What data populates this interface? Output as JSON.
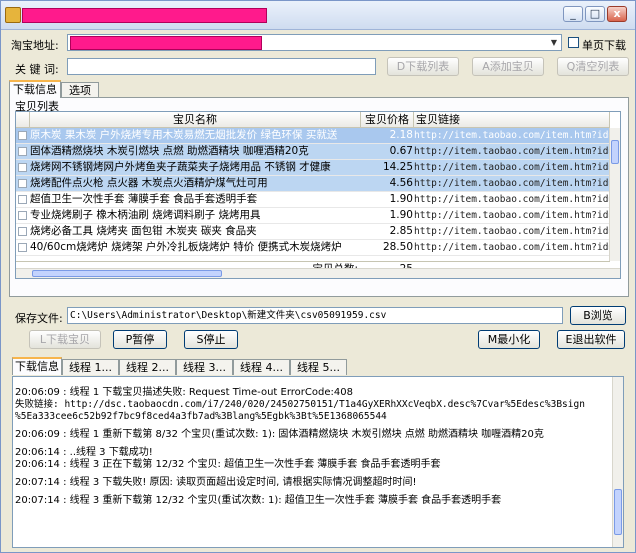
{
  "window": {
    "minimize_glyph": "_",
    "maximize_glyph": "□",
    "close_glyph": "x"
  },
  "top": {
    "url_label": "淘宝地址:",
    "single_page_label": "单页下载",
    "keyword_label": "关 键 词:",
    "download_list_button": "D下载列表",
    "add_item_button": "A添加宝贝",
    "clear_list_button": "Q清空列表"
  },
  "main_tabs": [
    {
      "label": "下载信息"
    },
    {
      "label": "选项"
    }
  ],
  "item_list": {
    "group_label": "宝贝列表",
    "columns": [
      "宝贝名称",
      "宝贝价格",
      "宝贝链接"
    ],
    "rows": [
      {
        "name": "原木炭 果木炭 户外烧烤专用木炭易燃无烟批发价 绿色环保 买就送",
        "price": "2.18",
        "link": "http://item.taobao.com/item.htm?id=2"
      },
      {
        "name": "固体酒精燃烧块 木炭引燃块 点燃 助燃酒精块 咖喱酒精20克",
        "price": "0.67",
        "link": "http://item.taobao.com/item.htm?id=2"
      },
      {
        "name": "烧烤网不锈钢烤网户外烤鱼夹子蔬菜夹子烧烤用品 不锈钢 才健康",
        "price": "14.25",
        "link": "http://item.taobao.com/item.htm?id=2"
      },
      {
        "name": "烧烤配件点火枪 点火器 木炭点火酒精炉煤气灶可用",
        "price": "4.56",
        "link": "http://item.taobao.com/item.htm?id=2"
      },
      {
        "name": "超值卫生一次性手套 薄膜手套 食品手套透明手套",
        "price": "1.90",
        "link": "http://item.taobao.com/item.htm?id=2"
      },
      {
        "name": "专业烧烤刷子 橡木柄油刷 烧烤调料刷子 烧烤用具",
        "price": "1.90",
        "link": "http://item.taobao.com/item.htm?id=2"
      },
      {
        "name": "烧烤必备工具 烧烤夹 面包钳 木炭夹 碳夹 食品夹",
        "price": "2.85",
        "link": "http://item.taobao.com/item.htm?id=1"
      },
      {
        "name": "40/60cm烧烤炉 烧烤架 户外冷扎板烧烤炉 特价 便携式木炭烧烤炉",
        "price": "28.50",
        "link": "http://item.taobao.com/item.htm?id=1"
      }
    ],
    "total_label": "宝贝总数:",
    "total_value": "25"
  },
  "save": {
    "label": "保存文件:",
    "path": "C:\\Users\\Administrator\\Desktop\\新建文件夹\\csv05091959.csv",
    "browse_button": "B浏览"
  },
  "actions": {
    "start_download_button": "L下载宝贝",
    "pause_button": "P暂停",
    "stop_button": "S停止",
    "minimize_button": "M最小化",
    "exit_button": "E退出软件"
  },
  "log_tabs": [
    {
      "label": "下载信息"
    },
    {
      "label": "线程 1..."
    },
    {
      "label": "线程 2..."
    },
    {
      "label": "线程 3..."
    },
    {
      "label": "线程 4..."
    },
    {
      "label": "线程 5..."
    }
  ],
  "log": {
    "line1": "20:06:09 : 线程 1 下载宝贝描述失败: Request Time-out ErrorCode:408",
    "line2": "  失败链接: http://dsc.taobaocdn.com/i7/240/020/24502750151/T1a4GyXERhXXcVeqbX.desc%7Cvar%5Edesc%3Bsign",
    "line3": "%5Ea333cee6c52b92f7bc9f8ced4a3fb7ad%3Blang%5Egbk%3Bt%5E1368065544",
    "line4": "20:06:09 : 线程 1 重新下载第 8/32 个宝贝(重试次数: 1): 固体酒精燃烧块 木炭引燃块 点燃 助燃酒精块 咖喱酒精20克",
    "line5": "20:06:14 : ..线程 3 下载成功!",
    "line6": "20:06:14 : 线程 3 正在下载第 12/32 个宝贝: 超值卫生一次性手套 薄膜手套 食品手套透明手套",
    "line7": "20:07:14 : 线程 3 下载失败! 原因: 读取页面超出设定时间, 请根据实际情况调整超时时间!",
    "line8": "20:07:14 : 线程 3 重新下载第 12/32 个宝贝(重试次数: 1): 超值卫生一次性手套 薄膜手套 食品手套透明手套"
  }
}
